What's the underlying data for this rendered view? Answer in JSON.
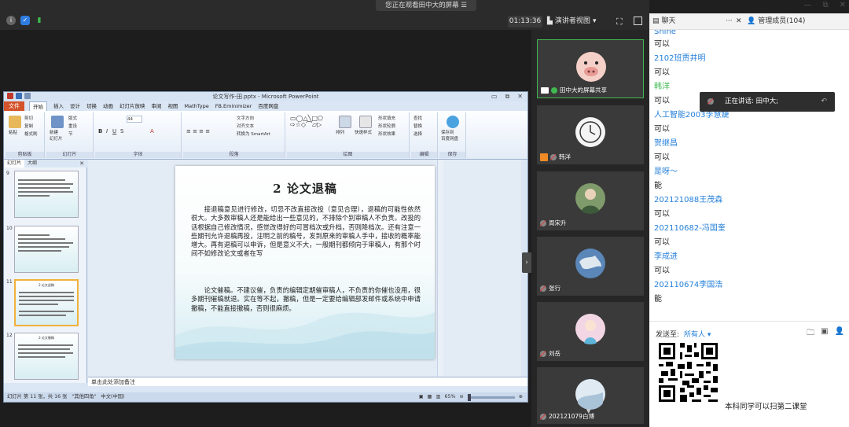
{
  "window": {
    "share_notice": "您正在观看田中大的屏幕",
    "share_menu_icon": "menu-icon",
    "timer": "01:13:36",
    "presenter_view": "演讲者视图",
    "controls": [
      "—",
      "⧉",
      "✕"
    ]
  },
  "tabs": {
    "chat_label": "聊天",
    "chat_more": "···",
    "chat_close": "✕",
    "members_label": "管理成员(104)"
  },
  "ppt": {
    "title": "论文写作-田.pptx - Microsoft PowerPoint",
    "menu": [
      "文件",
      "开始",
      "插入",
      "设计",
      "切换",
      "动画",
      "幻灯片放映",
      "审阅",
      "视图",
      "MathType",
      "FB.Eminimizer",
      "百度网盘"
    ],
    "ribbon": {
      "clipboard": {
        "label": "剪贴板",
        "paste": "粘贴",
        "cut": "剪切",
        "copy": "复制",
        "format_painter": "格式刷"
      },
      "slides": {
        "label": "幻灯片",
        "new_slide": "新建\n幻灯片",
        "layout": "版式",
        "reset": "重设",
        "section": "节"
      },
      "font": {
        "label": "字体",
        "size": "44"
      },
      "paragraph": {
        "label": "段落",
        "text_dir": "文字方向",
        "align_text": "对齐文本",
        "smartart": "转换为 SmartArt"
      },
      "drawing": {
        "label": "绘图",
        "arrange": "排列",
        "quick_styles": "快速样式",
        "fill": "形状填充",
        "outline": "形状轮廓",
        "effect": "形状效果"
      },
      "editing": {
        "label": "编辑",
        "find": "查找",
        "replace": "替换",
        "select": "选择"
      },
      "save": {
        "label": "保存",
        "save_baidu": "保存到\n百度网盘"
      }
    },
    "side_tabs": [
      "幻灯片",
      "大纲"
    ],
    "thumbnails": [
      {
        "num": "9",
        "title": ""
      },
      {
        "num": "10",
        "title": ""
      },
      {
        "num": "11",
        "title": "2 论文退稿"
      },
      {
        "num": "12",
        "title": "2 论文撤稿"
      }
    ],
    "slide": {
      "title": "2 论文退稿",
      "para1": "接退稿意见进行修改，切忌不改直接改投（意见合理），退稿的可能性依然很大。大多数审稿人还是能给出一些意见的，不排除个别审稿人不负责。改投的话根据自己修改情况，感觉改得好的可冒档次或升档，否则降档次。还有注意一些期刊允许退稿再投，注明之前的稿号，发到原来的审稿人手中，接收的概率能增大。再有退稿可以申诉，但是意义不大，一般期刊都倾向于审稿人，有那个时间不如修改论文或者在写",
      "para2": "论文催稿。不建议催，负责的编辑定期催审稿人，不负责的你催也没用，很多期刊催稿就退。实在等不起，撤稿，但是一定要给编辑部发邮件或系统中申请撤稿，不能直接撤稿，否则很麻烦。"
    },
    "notes_placeholder": "单击此处添加备注",
    "status": {
      "slide_info": "幻灯片 第 11 张，共 16 张",
      "theme": "\"其他四角\"",
      "language": "中文(中国)",
      "zoom": "65%"
    }
  },
  "videos": [
    {
      "name": "田中大的屏幕共享",
      "avatar": "pig-avatar",
      "speaking": true,
      "mic": "on",
      "badge": "share"
    },
    {
      "name": "韩洋",
      "avatar": "clock-avatar",
      "speaking": false,
      "mic": "off",
      "badge": "host"
    },
    {
      "name": "周宋升",
      "avatar": "photo-avatar",
      "speaking": false,
      "mic": "off",
      "badge": ""
    },
    {
      "name": "张行",
      "avatar": "earth-avatar",
      "speaking": false,
      "mic": "off",
      "badge": ""
    },
    {
      "name": "刘岳",
      "avatar": "cartoon-avatar",
      "speaking": false,
      "mic": "off",
      "badge": ""
    },
    {
      "name": "202121079白博",
      "avatar": "snow-avatar",
      "speaking": false,
      "mic": "off",
      "badge": ""
    }
  ],
  "chat": {
    "messages": [
      {
        "name": "Shine",
        "text": "可以"
      },
      {
        "name": "2102班贾井明",
        "text": "可以"
      },
      {
        "name": "韩洋",
        "text": "可以"
      },
      {
        "name": "人工智能2003李慧婕",
        "text": "可以"
      },
      {
        "name": "贺继昌",
        "text": "可以"
      },
      {
        "name": "是呀～",
        "text": "能"
      },
      {
        "name": "202121088王茂森",
        "text": "可以"
      },
      {
        "name": "202110682-冯国奎",
        "text": "可以"
      },
      {
        "name": "李成进",
        "text": "可以"
      },
      {
        "name": "202110674李国浩",
        "text": "能"
      }
    ],
    "speaking_toast": "正在讲话: 田中大;",
    "send_to_label": "发送至:",
    "send_to_target": "所有人 ▾",
    "qr_caption": "本科同学可以扫第二课堂"
  },
  "colors": {
    "link": "#2680d9",
    "speaking_border": "#3fb950",
    "ppt_file_tab": "#d4532a"
  }
}
